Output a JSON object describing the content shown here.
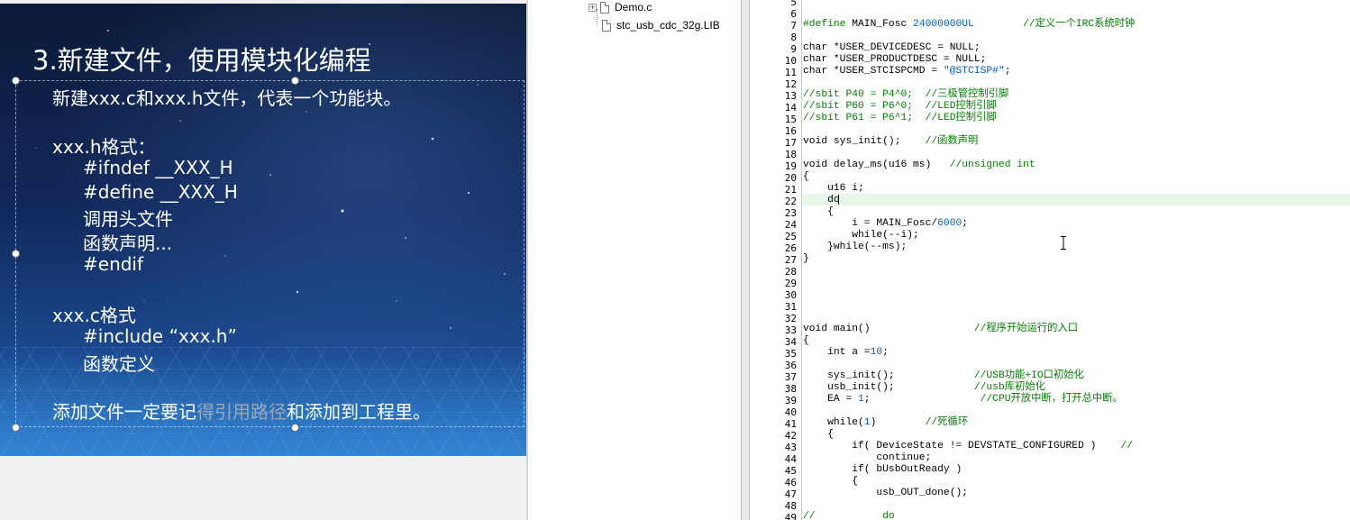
{
  "slide": {
    "title": "3.新建文件，使用模块化编程",
    "lines": {
      "intro": "新建xxx.c和xxx.h文件，代表一个功能块。",
      "h_heading": "xxx.h格式：",
      "h1": "#ifndef __XXX_H",
      "h2": "#define __XXX_H",
      "h3": "调用头文件",
      "h4": "函数声明...",
      "h5": "#endif",
      "c_heading": "xxx.c格式",
      "c1": "#include “xxx.h”",
      "c2": "函数定义",
      "footer_a": "添加文件一定要记",
      "footer_b": "得引用路径",
      "footer_c": "和添加到工程里。"
    }
  },
  "tree": {
    "items": [
      {
        "label": "Demo.c",
        "icon": "c-file-icon"
      },
      {
        "label": "stc_usb_cdc_32g.LIB",
        "icon": "lib-file-icon"
      }
    ]
  },
  "editor": {
    "line_numbers": [
      "5",
      "6",
      "7",
      "8",
      "9",
      "10",
      "11",
      "12",
      "13",
      "14",
      "15",
      "16",
      "17",
      "18",
      "19",
      "20",
      "21",
      "22",
      "23",
      "24",
      "25",
      "26",
      "27",
      "28",
      "29",
      "30",
      "31",
      "32",
      "33",
      "34",
      "35",
      "36",
      "37",
      "38",
      "39",
      "40",
      "41",
      "42",
      "43",
      "44",
      "45",
      "46",
      "47",
      "48",
      "49"
    ],
    "code": {
      "l7a": "#define",
      "l7b": " MAIN_Fosc ",
      "l7c": "24000000UL",
      "l7d": "        //定义一个IRC系统时钟",
      "l9": "char *USER_DEVICEDESC = NULL;",
      "l10": "char *USER_PRODUCTDESC = NULL;",
      "l11a": "char *USER_STCISPCMD = ",
      "l11b": "\"@STCISP#\"",
      "l11c": ";",
      "l13": "//sbit P40 = P4^0;  //三极管控制引脚",
      "l14": "//sbit P60 = P6^0;  //LED控制引脚",
      "l15": "//sbit P61 = P6^1;  //LED控制引脚",
      "l17a": "void sys_init();    ",
      "l17b": "//函数声明",
      "l19a": "void delay_ms(u16 ms)   ",
      "l19b": "//unsigned int",
      "l20": "{",
      "l21": "    u16 i;",
      "l22": "    do",
      "l23": "    {",
      "l24a": "        i = MAIN_Fosc/",
      "l24b": "6000",
      "l24c": ";",
      "l25": "        while(--i);",
      "l26": "    }while(--ms);",
      "l27": "}",
      "l33a": "void main()                 ",
      "l33b": "//程序开始运行的入口",
      "l34": "{",
      "l35a": "    int a =",
      "l35b": "10",
      "l35c": ";",
      "l37a": "    sys_init();             ",
      "l37b": "//USB功能+IO口初始化",
      "l38a": "    usb_init();             ",
      "l38b": "//usb库初始化",
      "l39a": "    EA = ",
      "l39b": "1",
      "l39c": ";                  ",
      "l39d": "//CPU开放中断，打开总中断。",
      "l41a": "    while(",
      "l41b": "1",
      "l41c": ")        ",
      "l41d": "//死循环",
      "l42": "    {",
      "l43a": "        if( DeviceState != DEVSTATE_CONFIGURED )    ",
      "l43b": "//",
      "l44": "            continue;",
      "l45": "        if( bUsbOutReady )",
      "l46": "        {",
      "l47": "            usb_OUT_done();",
      "l49a": "//",
      "l49b": "           do"
    }
  },
  "colors": {
    "comment": "#008000",
    "number": "#0060c0",
    "current_line": "#e6f7ea",
    "slide_bg": "#11285a"
  }
}
